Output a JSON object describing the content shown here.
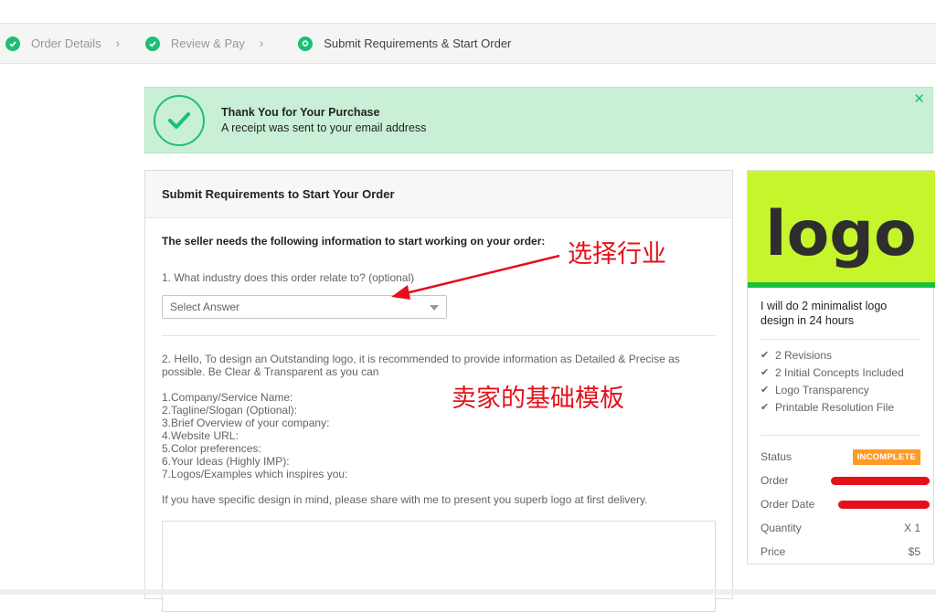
{
  "steps": [
    {
      "label": "Order Details",
      "state": "done"
    },
    {
      "label": "Review & Pay",
      "state": "done"
    },
    {
      "label": "Submit Requirements & Start Order",
      "state": "current"
    }
  ],
  "banner": {
    "title": "Thank You for Your Purchase",
    "subtitle": "A receipt was sent to your email address",
    "close": "✕"
  },
  "requirements": {
    "header": "Submit Requirements to Start Your Order",
    "intro": "The seller needs the following information to start working on your order:",
    "q1": "1. What industry does this order relate to? (optional)",
    "select_value": "Select Answer",
    "q2": "2. Hello, To design an Outstanding logo, it is recommended to provide information as Detailed & Precise as possible. Be Clear & Transparent as you can",
    "list": [
      "1.Company/Service Name:",
      "2.Tagline/Slogan (Optional):",
      "3.Brief Overview of your company:",
      "4.Website URL:",
      "5.Color preferences:",
      "6.Your Ideas (Highly IMP):",
      "7.Logos/Examples which inspires you:"
    ],
    "outro": "If you have specific design in mind, please share with me to present you superb logo at first delivery."
  },
  "annotations": {
    "industry": "选择行业",
    "template": "卖家的基础模板"
  },
  "gig": {
    "thumbnail_text": "logo",
    "title": "I will do 2 minimalist logo design in 24 hours",
    "features": [
      "2 Revisions",
      "2 Initial Concepts Included",
      "Logo Transparency",
      "Printable Resolution File"
    ],
    "status_label": "Status",
    "status_value": "INCOMPLETE",
    "order_label": "Order",
    "order_date_label": "Order Date",
    "quantity_label": "Quantity",
    "quantity_value": "X 1",
    "price_label": "Price",
    "price_value": "$5"
  },
  "colors": {
    "brand_green": "#1dbf73",
    "banner_bg": "#c9f0d6",
    "status_orange": "#ff9b26",
    "annotation_red": "#e4111a",
    "thumb_bg": "#c6f52c"
  }
}
